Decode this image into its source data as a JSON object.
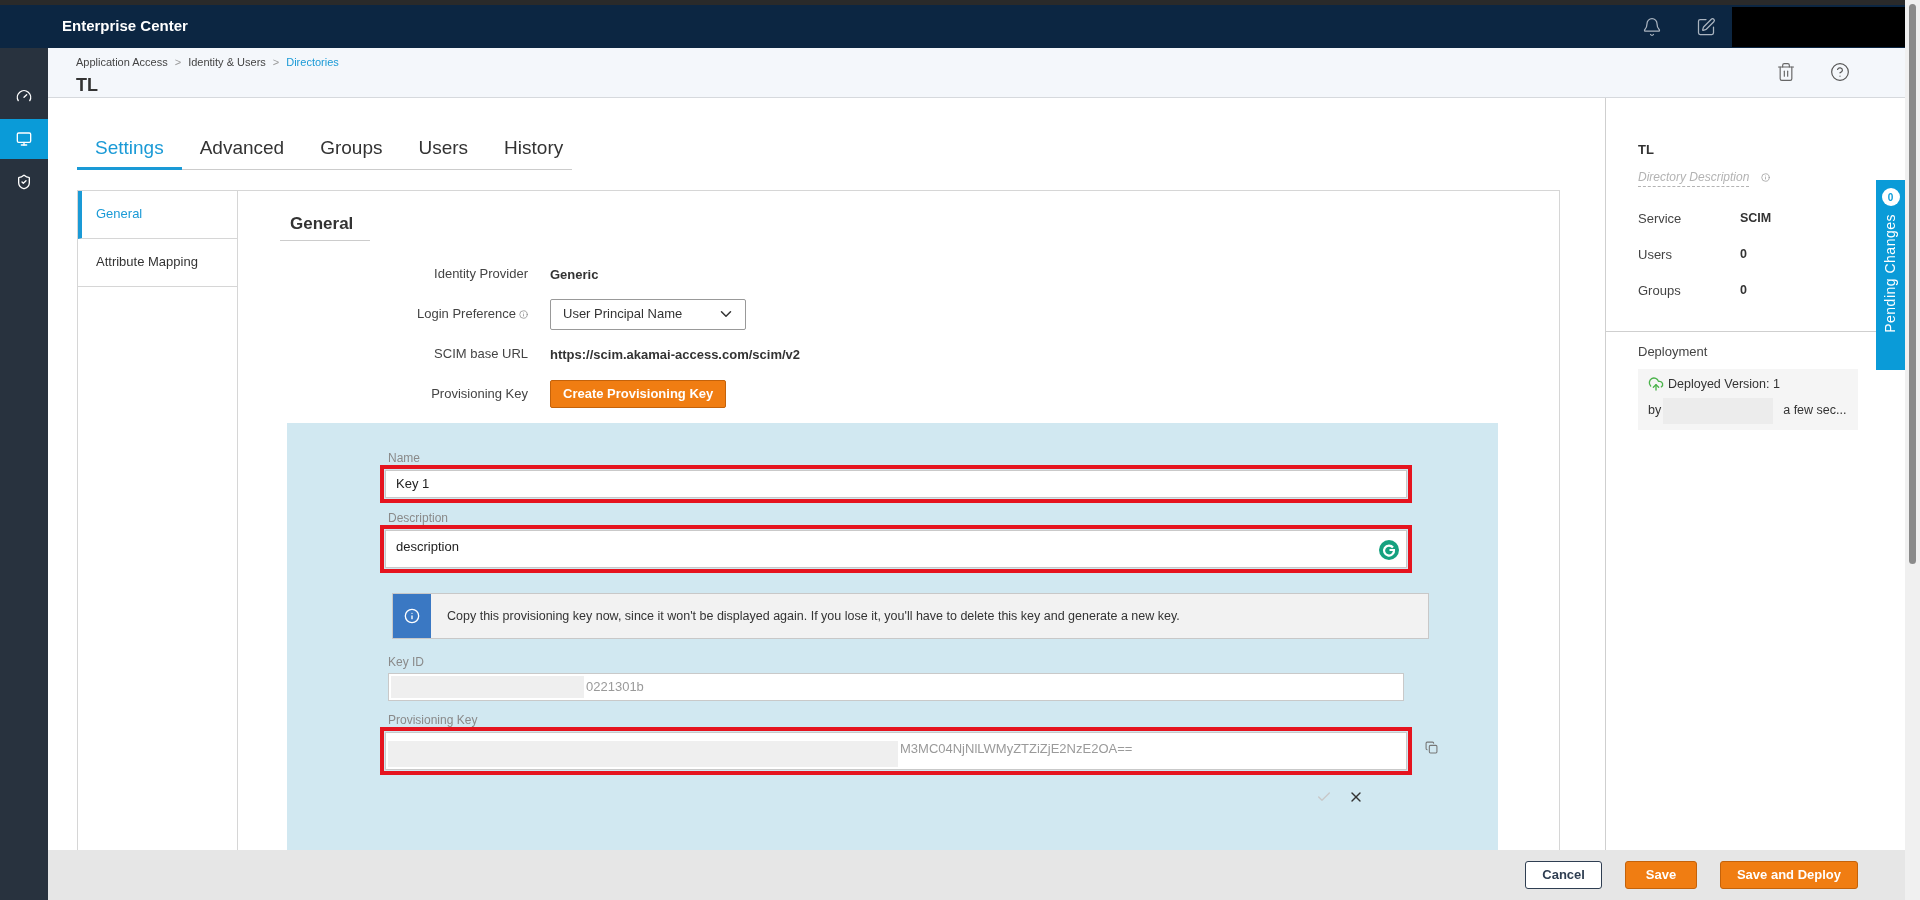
{
  "header": {
    "app_title": "Enterprise Center"
  },
  "nav": [
    {
      "kind": "gauge",
      "selected": false
    },
    {
      "kind": "monitor",
      "selected": true
    },
    {
      "kind": "shield",
      "selected": false
    }
  ],
  "breadcrumb": [
    {
      "label": "Application Access",
      "selected": false
    },
    {
      "label": "Identity & Users",
      "selected": false,
      "separator": ">"
    },
    {
      "label": "Directories",
      "selected": true,
      "separator": ">"
    }
  ],
  "page_title": "TL",
  "tabs": [
    {
      "label": "Settings",
      "selected": true
    },
    {
      "label": "Advanced",
      "selected": false
    },
    {
      "label": "Groups",
      "selected": false
    },
    {
      "label": "Users",
      "selected": false
    },
    {
      "label": "History",
      "selected": false
    }
  ],
  "subnav": [
    {
      "label": "General",
      "selected": true
    },
    {
      "label": "Attribute Mapping",
      "selected": false
    }
  ],
  "section_title": "General",
  "properties": [
    {
      "kind": "text",
      "label": "Identity Provider",
      "value": "Generic",
      "info": false
    },
    {
      "kind": "select",
      "label": "Login Preference",
      "value": "User Principal Name",
      "info": true
    },
    {
      "kind": "text",
      "label": "SCIM base URL",
      "value": "https://scim.akamai-access.com/scim/v2",
      "info": false
    },
    {
      "kind": "button",
      "label": "Provisioning Key",
      "value": "Create Provisioning Key",
      "info": false
    }
  ],
  "key_form": {
    "name": {
      "label": "Name",
      "value": "Key 1",
      "highlighted": true
    },
    "description": {
      "label": "Description",
      "value": "description",
      "highlighted": true
    },
    "notice": "Copy this provisioning key now, since it won't be displayed again. If you lose it, you'll have to delete this key and generate a new key.",
    "key_id": {
      "label": "Key ID",
      "value": "0221301b",
      "redacted": true,
      "highlighted": false
    },
    "provisioning_key": {
      "label": "Provisioning Key",
      "value": "M3MC04NjNlLWMyZTZiZjE2NzE2OA==",
      "redacted": true,
      "highlighted": true
    }
  },
  "summary": {
    "title": "TL",
    "description_placeholder": "Directory Description",
    "rows": [
      {
        "label": "Service",
        "value": "SCIM"
      },
      {
        "label": "Users",
        "value": "0"
      },
      {
        "label": "Groups",
        "value": "0"
      }
    ]
  },
  "deployment": {
    "title": "Deployment",
    "version": "Deployed Version: 1",
    "by": "by",
    "time": "a few sec...",
    "redacted": true
  },
  "pending_changes": {
    "label": "Pending Changes",
    "count": "0"
  },
  "footer_buttons": [
    {
      "label": "Cancel",
      "kind": "secondary"
    },
    {
      "label": "Save",
      "kind": "primary"
    },
    {
      "label": "Save and Deploy",
      "kind": "primary"
    }
  ]
}
